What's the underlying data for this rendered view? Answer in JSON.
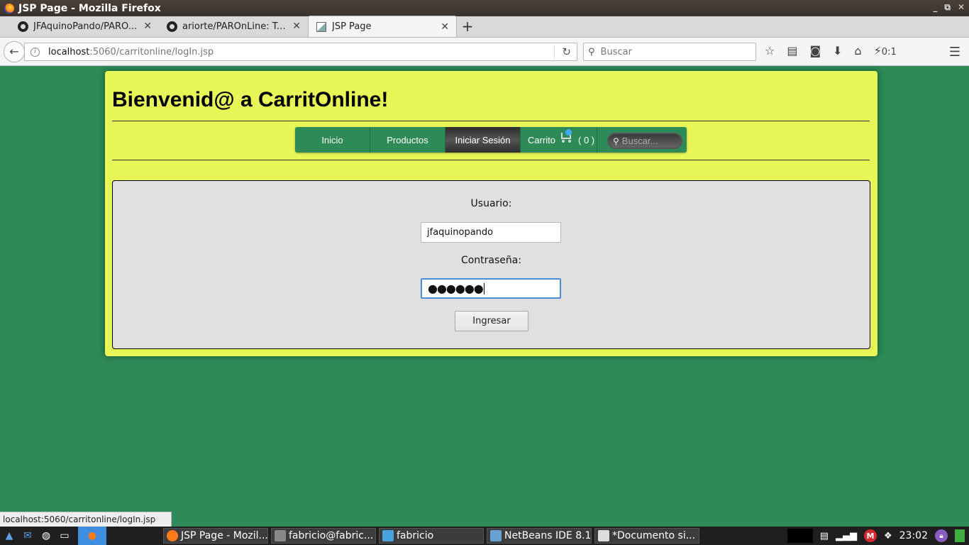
{
  "window": {
    "title": "JSP Page - Mozilla Firefox",
    "controls": [
      "_",
      "⧉",
      "✕"
    ]
  },
  "tabs": [
    {
      "label": "JFAquinoPando/PARO...",
      "icon": "github-icon",
      "active": false
    },
    {
      "label": "ariorte/PAROnLine: Tr...",
      "icon": "github-icon",
      "active": false
    },
    {
      "label": "JSP Page",
      "icon": "page-icon",
      "active": true
    }
  ],
  "tab_close": "✕",
  "newtab_label": "+",
  "navbar": {
    "url_host": "localhost",
    "url_path": ":5060/carritonline/logIn.jsp",
    "search_placeholder": "Buscar",
    "counter": "0:1"
  },
  "site": {
    "title": "Bienvenid@ a CarritOnline!",
    "menu": [
      "Inicio",
      "Productos",
      "Iniciar Sesión"
    ],
    "active_menu": "Iniciar Sesión",
    "cart_label": "Carrito",
    "cart_count": "( 0 )",
    "search_placeholder": "Buscar..."
  },
  "login": {
    "user_label": "Usuario:",
    "user_value": "jfaquinopando",
    "pass_label": "Contraseña:",
    "pass_value": "●●●●●●",
    "submit_label": "Ingresar"
  },
  "status_tip": "localhost:5060/carritonline/logIn.jsp",
  "taskbar": {
    "tasks": [
      {
        "label": "JSP Page - Mozil...",
        "icon": "firefox-icon",
        "color": "#ff7a1a"
      },
      {
        "label": "fabricio@fabric...",
        "icon": "terminal-icon",
        "color": "#888888"
      },
      {
        "label": "fabricio",
        "icon": "folder-icon",
        "color": "#4aa3df"
      },
      {
        "label": "NetBeans IDE 8.1",
        "icon": "netbeans-icon",
        "color": "#6a9fd4"
      },
      {
        "label": "*Documento si...",
        "icon": "document-icon",
        "color": "#dddddd"
      }
    ],
    "clock": "23:02"
  },
  "colors": {
    "page_bg": "#2e8b57",
    "container_bg": "#e8f557",
    "login_bg": "#e0e0e0",
    "focus": "#4a90d9"
  }
}
